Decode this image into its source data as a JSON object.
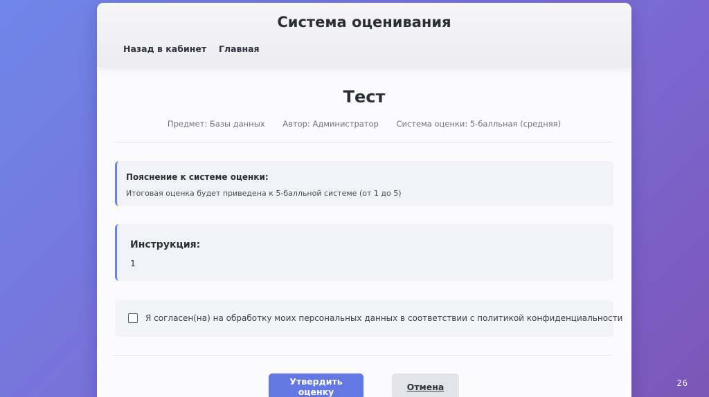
{
  "header": {
    "title": "Система оценивания",
    "nav": {
      "back": "Назад в кабинет",
      "home": "Главная"
    }
  },
  "test": {
    "title": "Тест",
    "meta": {
      "subject": "Предмет: Базы данных",
      "author": "Автор: Администратор",
      "grading": "Система оценки: 5-балльная (средняя)"
    }
  },
  "grading_info": {
    "heading": "Пояснение к системе оценки:",
    "text": "Итоговая оценка будет приведена к 5-балльной системе (от 1 до 5)"
  },
  "instructions": {
    "heading": "Инструкция:",
    "text": "1"
  },
  "consent": {
    "checked": false,
    "label": "Я согласен(на) на обработку моих персональных данных в соответствии с политикой конфиденциальности"
  },
  "actions": {
    "submit": "Утвердить оценку",
    "cancel": "Отмена"
  },
  "page_number": "26",
  "colors": {
    "accent": "#6478e4",
    "accent_border": "#6d7fe0",
    "background_start": "#6f86e8",
    "background_end": "#7c56b8"
  }
}
